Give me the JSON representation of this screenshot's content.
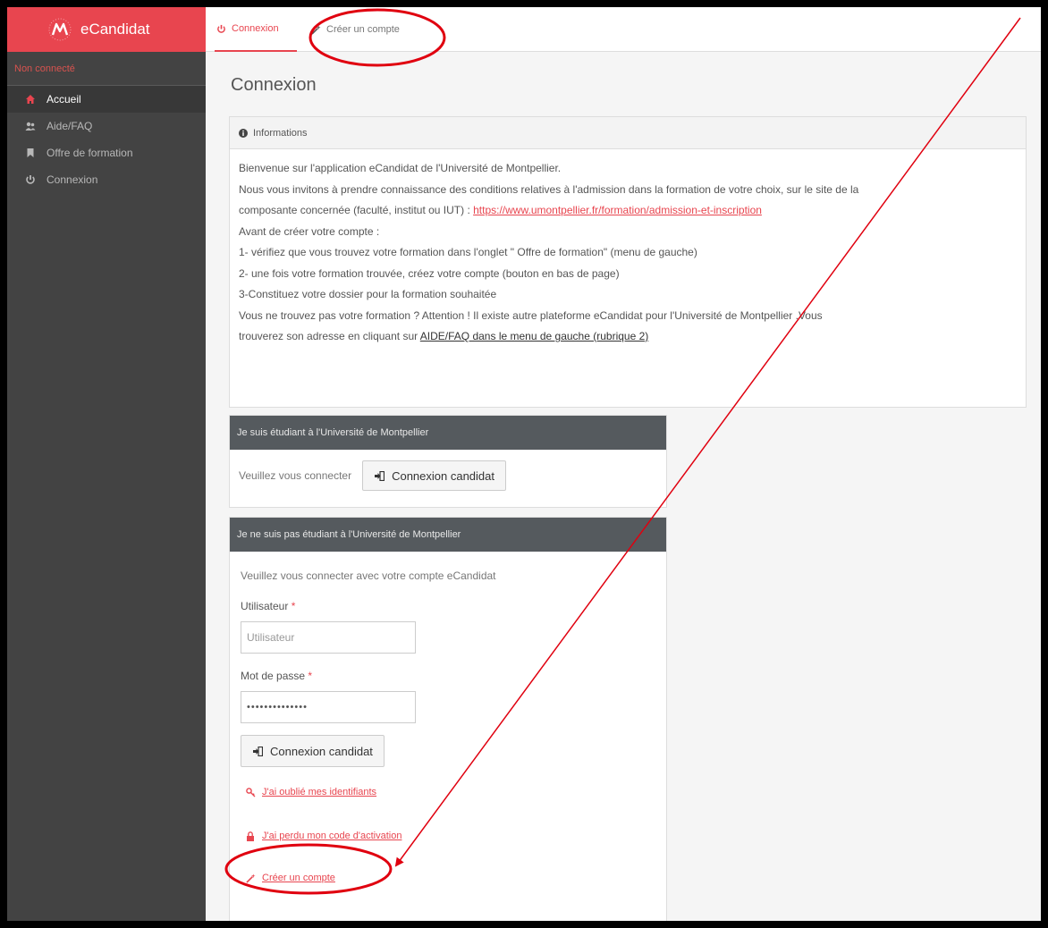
{
  "brand": {
    "title": "eCandidat",
    "accent": "#e8454f"
  },
  "sidebar": {
    "status": "Non connecté",
    "items": [
      {
        "label": "Accueil",
        "icon": "home-icon",
        "active": true
      },
      {
        "label": "Aide/FAQ",
        "icon": "users-icon",
        "active": false
      },
      {
        "label": "Offre de formation",
        "icon": "bookmark-icon",
        "active": false
      },
      {
        "label": "Connexion",
        "icon": "power-icon",
        "active": false
      }
    ]
  },
  "tabs": [
    {
      "label": "Connexion",
      "icon": "power-icon",
      "active": true
    },
    {
      "label": "Créer un compte",
      "icon": "magic-wand-icon",
      "active": false
    }
  ],
  "main": {
    "title": "Connexion",
    "info": {
      "heading": "Informations",
      "line1": "Bienvenue sur l'application eCandidat de l'Université de Montpellier.",
      "line2": "Nous vous invitons à prendre connaissance des conditions relatives à l'admission dans la formation de votre choix, sur le site de la",
      "line3_prefix": "composante concernée (faculté, institut ou IUT) : ",
      "line3_link": "https://www.umontpellier.fr/formation/admission-et-inscription",
      "line4": "Avant de créer votre compte :",
      "line5": "1- vérifiez que vous trouvez votre formation dans l'onglet \" Offre de formation\" (menu de gauche)",
      "line6": "2- une fois votre formation trouvée, créez votre compte (bouton en bas de page)",
      "line7": "3-Constituez votre dossier pour la formation souhaitée",
      "line8": "Vous ne trouvez pas votre formation ? Attention ! Il existe autre plateforme eCandidat pour l'Université de Montpellier .Vous",
      "line9_prefix": "trouverez son adresse en cliquant sur ",
      "line9_link": "AIDE/FAQ dans le menu de gauche (rubrique 2)"
    },
    "student_panel": {
      "heading": "Je suis étudiant à l'Université de Montpellier",
      "prompt": "Veuillez vous connecter",
      "button": "Connexion candidat"
    },
    "other_panel": {
      "heading": "Je ne suis pas étudiant à l'Université de Montpellier",
      "intro": "Veuillez vous connecter avec votre compte eCandidat",
      "user_label": "Utilisateur",
      "user_placeholder": "Utilisateur",
      "password_label": "Mot de passe",
      "password_value": "••••••••••••••",
      "required_mark": "*",
      "button": "Connexion candidat",
      "forgot_ids": "J'ai oublié mes identifiants",
      "lost_code": "J'ai perdu mon code d'activation",
      "create_account": "Créer un compte"
    }
  },
  "annotation_color": "#e0000f"
}
